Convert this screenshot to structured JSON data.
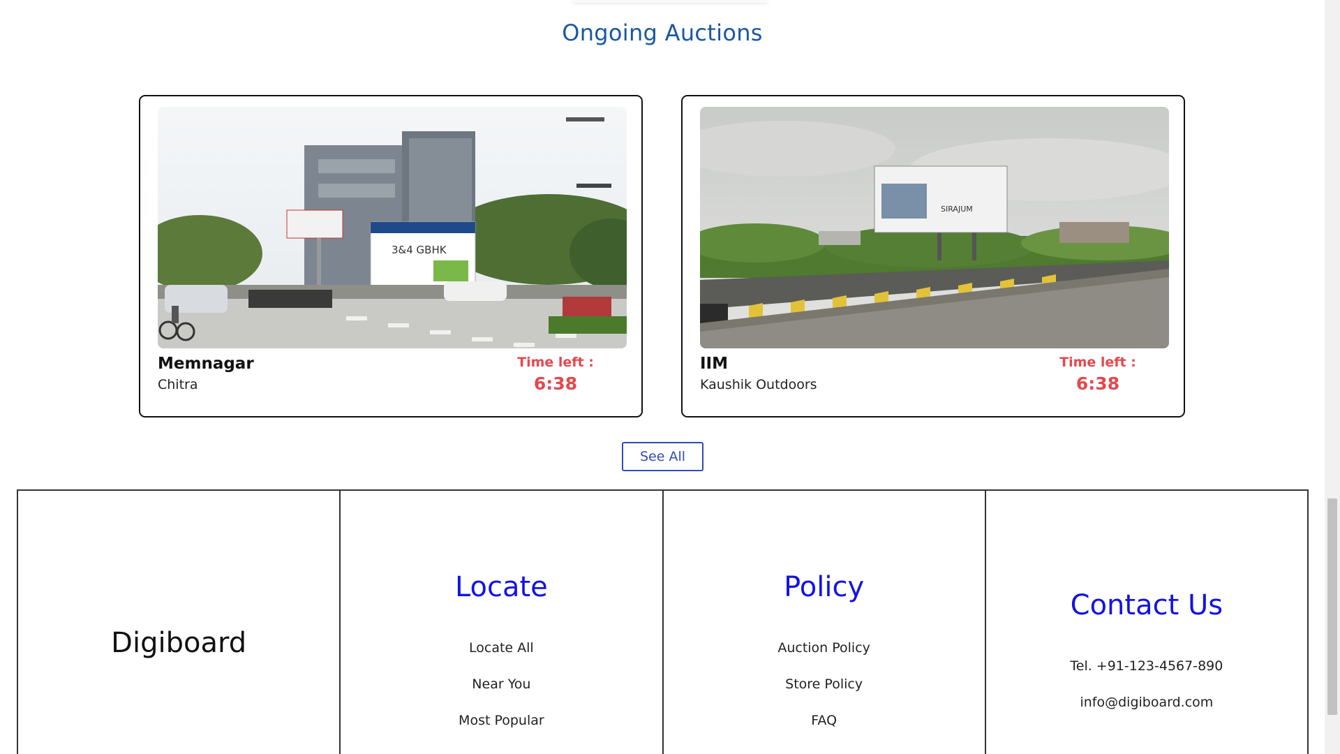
{
  "section": {
    "title": "Ongoing Auctions"
  },
  "auctions": [
    {
      "name": "Memnagar",
      "owner": "Chitra",
      "time_label": "Time left :",
      "time_left": "6:38",
      "billboard_text": "3&4 GBHK"
    },
    {
      "name": "IIM",
      "owner": "Kaushik Outdoors",
      "time_label": "Time left :",
      "time_left": "6:38",
      "billboard_text": "SIRAJUM"
    }
  ],
  "see_all_label": "See All",
  "footer": {
    "brand": "Digiboard",
    "locate": {
      "title": "Locate",
      "links": [
        "Locate All",
        "Near You",
        "Most Popular"
      ]
    },
    "policy": {
      "title": "Policy",
      "links": [
        "Auction Policy",
        "Store Policy",
        "FAQ"
      ]
    },
    "contact": {
      "title": "Contact Us",
      "phone": "Tel. +91-123-4567-890",
      "email": "info@digiboard.com"
    }
  },
  "colors": {
    "title_blue": "#1a57a3",
    "footer_heading_blue": "#1212e6",
    "timer_red": "#e5484d",
    "button_blue": "#2f4bb8"
  }
}
